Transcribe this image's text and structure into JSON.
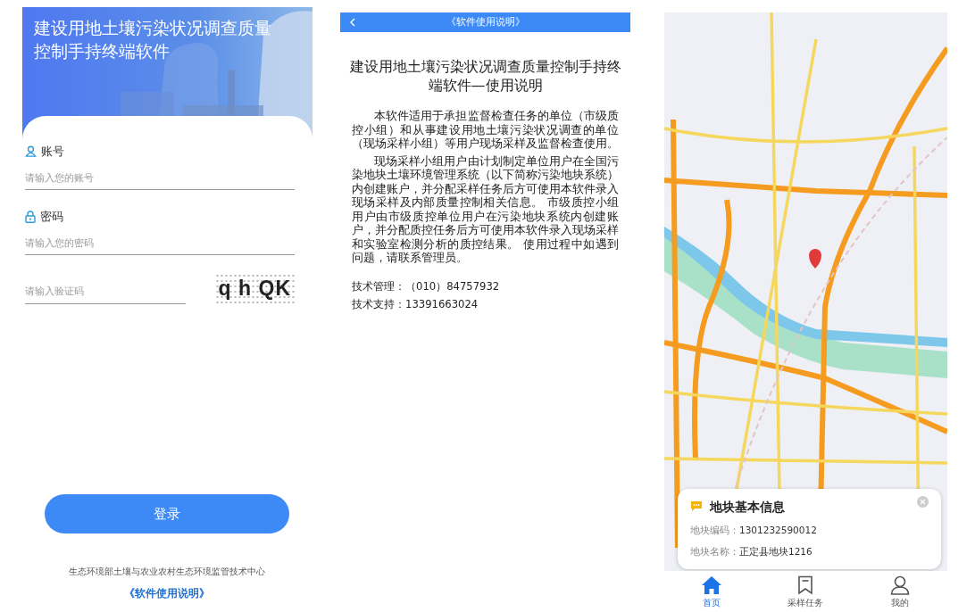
{
  "login": {
    "title": "建设用地土壤污染状况调查质量控制手持终端软件",
    "fields": [
      {
        "label": "账号",
        "kind": "user",
        "placeholder": "请输入您的账号"
      },
      {
        "label": "密码",
        "kind": "lock",
        "placeholder": "请输入您的密码"
      }
    ],
    "captcha": {
      "placeholder": "请输入验证码",
      "code": "q h QK"
    },
    "button": "登录",
    "footer": "生态环境部土壤与农业农村生态环境监管技术中心",
    "manual_link": "《软件使用说明》"
  },
  "manual": {
    "header": "《软件使用说明》",
    "title": "建设用地土壤污染状况调查质量控制手持终端软件—使用说明",
    "paragraphs": [
      "本软件适用于承担监督检查任务的单位（市级质控小组）和从事建设用地土壤污染状况调查的单位（现场采样小组）等用户现场采样及监督检查使用。",
      "现场采样小组用户由计划制定单位用户在全国污染地块土壤环境管理系统（以下简称污染地块系统）内创建账户，并分配采样任务后方可使用本软件录入现场采样及内部质量控制相关信息。 市级质控小组用户由市级质控单位用户在污染地块系统内创建账户，并分配质控任务后方可使用本软件录入现场采样和实验室检测分析的质控结果。 使用过程中如遇到问题，请联系管理员。"
    ],
    "contacts": [
      "技术管理：（010）84757932",
      "技术支持：13391663024"
    ]
  },
  "map": {
    "info": {
      "title": "地块基本信息",
      "rows": [
        {
          "label": "地块编码：",
          "value": "1301232590012"
        },
        {
          "label": "地块名称：",
          "value": "正定县地块1216"
        }
      ]
    },
    "nav": [
      {
        "label": "首页",
        "kind": "home",
        "selected": true
      },
      {
        "label": "采样任务",
        "kind": "bookmark",
        "selected": false
      },
      {
        "label": "我的",
        "kind": "person",
        "selected": false
      }
    ]
  }
}
